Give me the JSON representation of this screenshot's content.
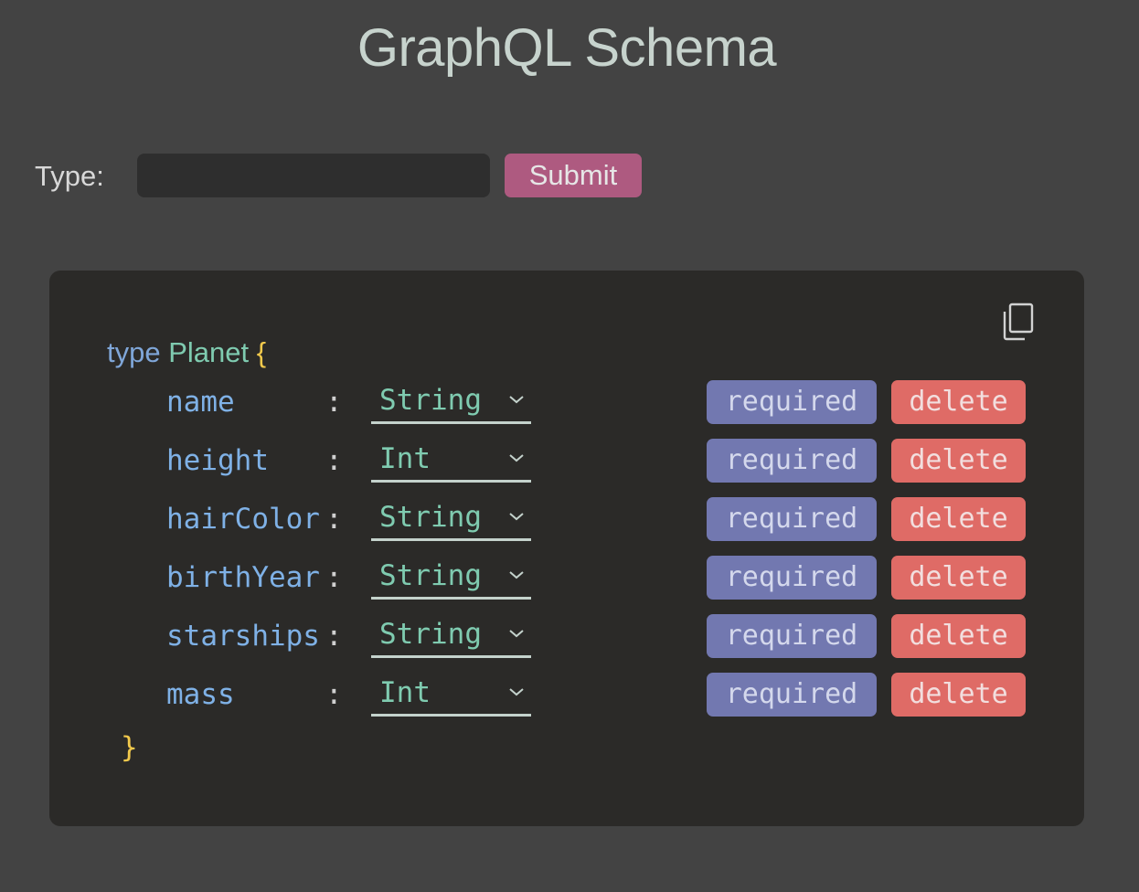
{
  "header": {
    "title": "GraphQL Schema"
  },
  "form": {
    "type_label": "Type:",
    "type_value": "",
    "type_placeholder": "",
    "submit_label": "Submit"
  },
  "schema": {
    "keyword": "type",
    "type_name": "Planet",
    "open_brace": "{",
    "close_brace": "}",
    "colon": ":",
    "copy_icon": "copy-icon",
    "fields": [
      {
        "name": "name",
        "type": "String",
        "required_label": "required",
        "delete_label": "delete"
      },
      {
        "name": "height",
        "type": "Int",
        "required_label": "required",
        "delete_label": "delete"
      },
      {
        "name": "hairColor",
        "type": "String",
        "required_label": "required",
        "delete_label": "delete"
      },
      {
        "name": "birthYear",
        "type": "String",
        "required_label": "required",
        "delete_label": "delete"
      },
      {
        "name": "starships",
        "type": "String",
        "required_label": "required",
        "delete_label": "delete"
      },
      {
        "name": "mass",
        "type": "Int",
        "required_label": "required",
        "delete_label": "delete"
      }
    ]
  },
  "colors": {
    "background": "#434343",
    "panel": "#2b2a28",
    "submit": "#ae5a80",
    "required": "#7278b0",
    "delete": "#df6b66",
    "keyword": "#7fa6d8",
    "type_name": "#7fcbb0",
    "brace": "#f2c94c"
  }
}
